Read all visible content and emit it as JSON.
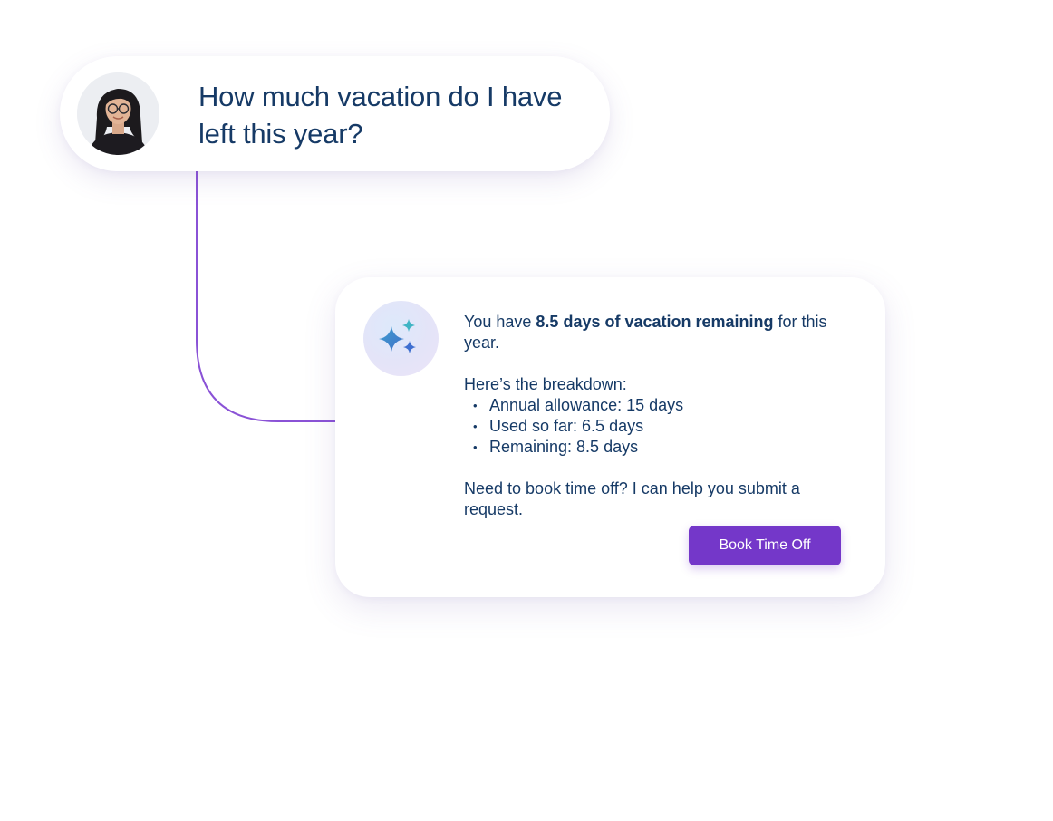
{
  "conversation": {
    "user_message": {
      "avatar_icon": "user-avatar-photo",
      "text": "How much vacation do I have left this year?"
    },
    "assistant_message": {
      "avatar_icon": "sparkles-icon",
      "intro_prefix": "You have ",
      "intro_highlight": "8.5 days of vacation remaining",
      "intro_suffix": " for this year.",
      "breakdown_heading": "Here’s the breakdown:",
      "breakdown_items": [
        "Annual allowance: 15 days",
        "Used so far: 6.5 days",
        "Remaining: 8.5 days"
      ],
      "closing": "Need to book time off? I can help you submit a request.",
      "action_button_label": "Book Time Off"
    }
  },
  "colors": {
    "text_primary": "#163a66",
    "accent_purple": "#7437c9",
    "connector_line": "#8a52d6",
    "sparkle_blue": "#3f7fd0",
    "sparkle_teal": "#3fb4c4"
  }
}
